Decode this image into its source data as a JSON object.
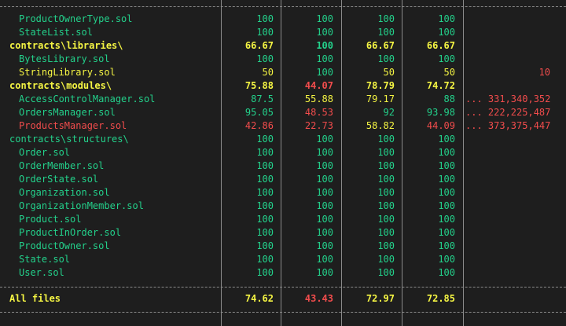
{
  "colors": {
    "background": "#1e1e1e",
    "good": "#23d18b",
    "medium": "#f5f543",
    "low": "#f14c4c",
    "separator": "#8a8a8a"
  },
  "rows": [
    {
      "file": "ProductOwnerType.sol",
      "indent": true,
      "bold": false,
      "file_color": "green",
      "stmts": "100",
      "branch": "100",
      "funcs": "100",
      "lines": "100",
      "uncovered": "",
      "colors": [
        "green",
        "green",
        "green",
        "green",
        "green"
      ]
    },
    {
      "file": "StateList.sol",
      "indent": true,
      "bold": false,
      "file_color": "green",
      "stmts": "100",
      "branch": "100",
      "funcs": "100",
      "lines": "100",
      "uncovered": "",
      "colors": [
        "green",
        "green",
        "green",
        "green",
        "green"
      ]
    },
    {
      "file": "contracts\\libraries\\",
      "indent": false,
      "bold": true,
      "file_color": "yellow",
      "stmts": "66.67",
      "branch": "100",
      "funcs": "66.67",
      "lines": "66.67",
      "uncovered": "",
      "colors": [
        "yellow",
        "green",
        "yellow",
        "yellow",
        "green"
      ]
    },
    {
      "file": "BytesLibrary.sol",
      "indent": true,
      "bold": false,
      "file_color": "green",
      "stmts": "100",
      "branch": "100",
      "funcs": "100",
      "lines": "100",
      "uncovered": "",
      "colors": [
        "green",
        "green",
        "green",
        "green",
        "green"
      ]
    },
    {
      "file": "StringLibrary.sol",
      "indent": true,
      "bold": false,
      "file_color": "yellow",
      "stmts": "50",
      "branch": "100",
      "funcs": "50",
      "lines": "50",
      "uncovered": "10",
      "colors": [
        "yellow",
        "green",
        "yellow",
        "yellow",
        "red"
      ]
    },
    {
      "file": "contracts\\modules\\",
      "indent": false,
      "bold": true,
      "file_color": "yellow",
      "stmts": "75.88",
      "branch": "44.07",
      "funcs": "78.79",
      "lines": "74.72",
      "uncovered": "",
      "colors": [
        "yellow",
        "red",
        "yellow",
        "yellow",
        "red"
      ]
    },
    {
      "file": "AccessControlManager.sol",
      "indent": true,
      "bold": false,
      "file_color": "green",
      "stmts": "87.5",
      "branch": "55.88",
      "funcs": "79.17",
      "lines": "88",
      "uncovered": "... 331,340,352",
      "colors": [
        "green",
        "yellow",
        "yellow",
        "green",
        "red"
      ]
    },
    {
      "file": "OrdersManager.sol",
      "indent": true,
      "bold": false,
      "file_color": "green",
      "stmts": "95.05",
      "branch": "48.53",
      "funcs": "92",
      "lines": "93.98",
      "uncovered": "... 222,225,487",
      "colors": [
        "green",
        "red",
        "green",
        "green",
        "red"
      ]
    },
    {
      "file": "ProductsManager.sol",
      "indent": true,
      "bold": false,
      "file_color": "red",
      "stmts": "42.86",
      "branch": "22.73",
      "funcs": "58.82",
      "lines": "44.09",
      "uncovered": "... 373,375,447",
      "colors": [
        "red",
        "red",
        "yellow",
        "red",
        "red"
      ]
    },
    {
      "file": "contracts\\structures\\",
      "indent": false,
      "bold": false,
      "file_color": "green",
      "stmts": "100",
      "branch": "100",
      "funcs": "100",
      "lines": "100",
      "uncovered": "",
      "colors": [
        "green",
        "green",
        "green",
        "green",
        "green"
      ]
    },
    {
      "file": "Order.sol",
      "indent": true,
      "bold": false,
      "file_color": "green",
      "stmts": "100",
      "branch": "100",
      "funcs": "100",
      "lines": "100",
      "uncovered": "",
      "colors": [
        "green",
        "green",
        "green",
        "green",
        "green"
      ]
    },
    {
      "file": "OrderMember.sol",
      "indent": true,
      "bold": false,
      "file_color": "green",
      "stmts": "100",
      "branch": "100",
      "funcs": "100",
      "lines": "100",
      "uncovered": "",
      "colors": [
        "green",
        "green",
        "green",
        "green",
        "green"
      ]
    },
    {
      "file": "OrderState.sol",
      "indent": true,
      "bold": false,
      "file_color": "green",
      "stmts": "100",
      "branch": "100",
      "funcs": "100",
      "lines": "100",
      "uncovered": "",
      "colors": [
        "green",
        "green",
        "green",
        "green",
        "green"
      ]
    },
    {
      "file": "Organization.sol",
      "indent": true,
      "bold": false,
      "file_color": "green",
      "stmts": "100",
      "branch": "100",
      "funcs": "100",
      "lines": "100",
      "uncovered": "",
      "colors": [
        "green",
        "green",
        "green",
        "green",
        "green"
      ]
    },
    {
      "file": "OrganizationMember.sol",
      "indent": true,
      "bold": false,
      "file_color": "green",
      "stmts": "100",
      "branch": "100",
      "funcs": "100",
      "lines": "100",
      "uncovered": "",
      "colors": [
        "green",
        "green",
        "green",
        "green",
        "green"
      ]
    },
    {
      "file": "Product.sol",
      "indent": true,
      "bold": false,
      "file_color": "green",
      "stmts": "100",
      "branch": "100",
      "funcs": "100",
      "lines": "100",
      "uncovered": "",
      "colors": [
        "green",
        "green",
        "green",
        "green",
        "green"
      ]
    },
    {
      "file": "ProductInOrder.sol",
      "indent": true,
      "bold": false,
      "file_color": "green",
      "stmts": "100",
      "branch": "100",
      "funcs": "100",
      "lines": "100",
      "uncovered": "",
      "colors": [
        "green",
        "green",
        "green",
        "green",
        "green"
      ]
    },
    {
      "file": "ProductOwner.sol",
      "indent": true,
      "bold": false,
      "file_color": "green",
      "stmts": "100",
      "branch": "100",
      "funcs": "100",
      "lines": "100",
      "uncovered": "",
      "colors": [
        "green",
        "green",
        "green",
        "green",
        "green"
      ]
    },
    {
      "file": "State.sol",
      "indent": true,
      "bold": false,
      "file_color": "green",
      "stmts": "100",
      "branch": "100",
      "funcs": "100",
      "lines": "100",
      "uncovered": "",
      "colors": [
        "green",
        "green",
        "green",
        "green",
        "green"
      ]
    },
    {
      "file": "User.sol",
      "indent": true,
      "bold": false,
      "file_color": "green",
      "stmts": "100",
      "branch": "100",
      "funcs": "100",
      "lines": "100",
      "uncovered": "",
      "colors": [
        "green",
        "green",
        "green",
        "green",
        "green"
      ]
    }
  ],
  "total": {
    "file": "All files",
    "bold": true,
    "file_color": "yellow",
    "stmts": "74.62",
    "branch": "43.43",
    "funcs": "72.97",
    "lines": "72.85",
    "uncovered": "",
    "colors": [
      "yellow",
      "red",
      "yellow",
      "yellow",
      "red"
    ]
  }
}
